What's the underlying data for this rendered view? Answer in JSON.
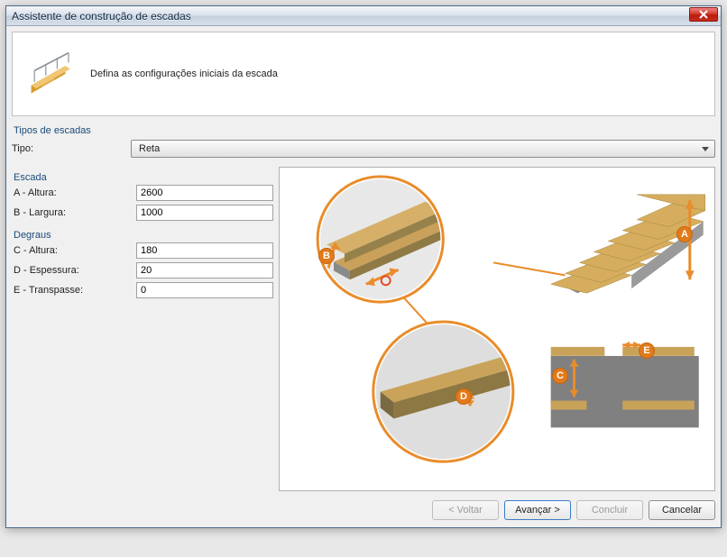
{
  "window": {
    "title": "Assistente de construção de escadas",
    "close_label": "Close"
  },
  "header": {
    "message": "Defina as configurações iniciais da escada"
  },
  "stair_types": {
    "group_label": "Tipos de escadas",
    "type_label": "Tipo:",
    "selected": "Reta"
  },
  "stair": {
    "section_label": "Escada",
    "height_label": "A - Altura:",
    "height_value": "2600",
    "width_label": "B - Largura:",
    "width_value": "1000"
  },
  "steps": {
    "section_label": "Degraus",
    "step_height_label": "C - Altura:",
    "step_height_value": "180",
    "thickness_label": "D - Espessura:",
    "thickness_value": "20",
    "overlap_label": "E - Transpasse:",
    "overlap_value": "0"
  },
  "badges": {
    "A": "A",
    "B": "B",
    "C": "C",
    "D": "D",
    "E": "E"
  },
  "buttons": {
    "back": "< Voltar",
    "next": "Avançar >",
    "finish": "Concluir",
    "cancel": "Cancelar"
  }
}
